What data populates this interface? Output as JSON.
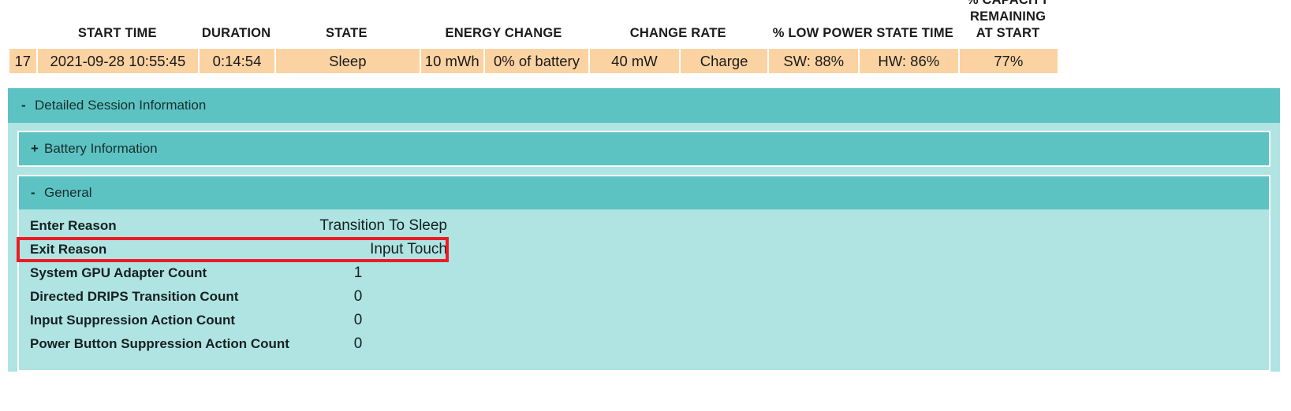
{
  "summary": {
    "headers": [
      {
        "key": "index",
        "label": ""
      },
      {
        "key": "start_time",
        "label": "START TIME"
      },
      {
        "key": "duration",
        "label": "DURATION"
      },
      {
        "key": "state",
        "label": "STATE"
      },
      {
        "key": "energy_change",
        "label": "ENERGY CHANGE"
      },
      {
        "key": "change_rate",
        "label": "CHANGE RATE"
      },
      {
        "key": "low_power_state_time",
        "label": "% LOW POWER STATE TIME"
      },
      {
        "key": "capacity_remaining",
        "label": "% CAPACITY\nREMAINING\nAT START"
      }
    ],
    "row": {
      "index": "17",
      "start_time": "2021-09-28   10:55:45",
      "duration": "0:14:54",
      "state": "Sleep",
      "energy_change_mwh": "10 mWh",
      "energy_change_pct": "0% of battery",
      "change_rate": "40 mW",
      "change_direction": "Charge",
      "low_power_sw": "SW: 88%",
      "low_power_hw": "HW: 86%",
      "capacity_remaining": "77%"
    }
  },
  "detailed_session": {
    "title": "Detailed Session Information",
    "toggle": "-",
    "expanded": true,
    "sections": [
      {
        "title": "Battery Information",
        "toggle": "+",
        "expanded": false,
        "rows": []
      },
      {
        "title": "General",
        "toggle": "-",
        "expanded": true,
        "rows": [
          {
            "key": "Enter Reason",
            "value": "Transition To Sleep",
            "type": "text"
          },
          {
            "key": "Exit Reason",
            "value": "Input Touch",
            "type": "text",
            "highlighted": true
          },
          {
            "key": "System GPU Adapter Count",
            "value": "1",
            "type": "number"
          },
          {
            "key": "Directed DRIPS Transition Count",
            "value": "0",
            "type": "number"
          },
          {
            "key": "Input Suppression Action Count",
            "value": "0",
            "type": "number"
          },
          {
            "key": "Power Button Suppression Action Count",
            "value": "0",
            "type": "number"
          }
        ]
      }
    ]
  },
  "colors": {
    "teal_header": "#5DC3C2",
    "teal_body": "#AFE4E3",
    "row_orange": "#FBD3A2",
    "highlight_red": "#ED1C24",
    "text_dark": "#16201f",
    "page_background": "#FFFFFF"
  }
}
